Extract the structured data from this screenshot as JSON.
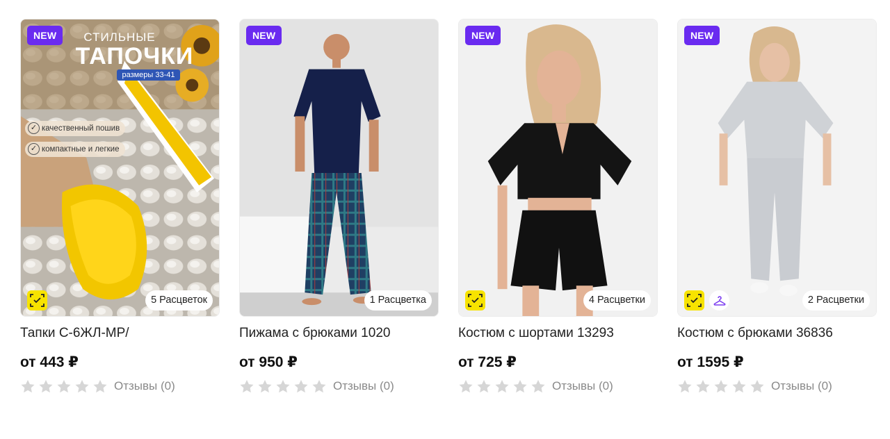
{
  "products": [
    {
      "badge": "NEW",
      "title": "Тапки С-6ЖЛ-МР/",
      "price": "от 443 ₽",
      "colors": "5 Расцветок",
      "reviews": "Отзывы (0)",
      "rating": 0,
      "banner": {
        "line1": "СТИЛЬНЫЕ",
        "line2": "ТАПОЧКИ",
        "sizes": "размеры 33-41",
        "feature1": "качественный пошив",
        "feature2": "компактные и легкие"
      }
    },
    {
      "badge": "NEW",
      "title": "Пижама с брюками 1020",
      "price": "от 950 ₽",
      "colors": "1 Расцветка",
      "reviews": "Отзывы (0)",
      "rating": 0
    },
    {
      "badge": "NEW",
      "title": "Костюм с шортами 13293",
      "price": "от 725 ₽",
      "colors": "4 Расцветки",
      "reviews": "Отзывы (0)",
      "rating": 0
    },
    {
      "badge": "NEW",
      "title": "Костюм с брюками 36836",
      "price": "от 1595 ₽",
      "colors": "2 Расцветки",
      "reviews": "Отзывы (0)",
      "rating": 0
    }
  ],
  "colors": {
    "badge_bg": "#6a2bf0",
    "fit_icon_bg": "#f7e300",
    "star_empty": "#d6d6d6"
  },
  "icons": {
    "fit": "size-fit-icon",
    "hanger": "hanger-icon",
    "star": "star-icon"
  }
}
